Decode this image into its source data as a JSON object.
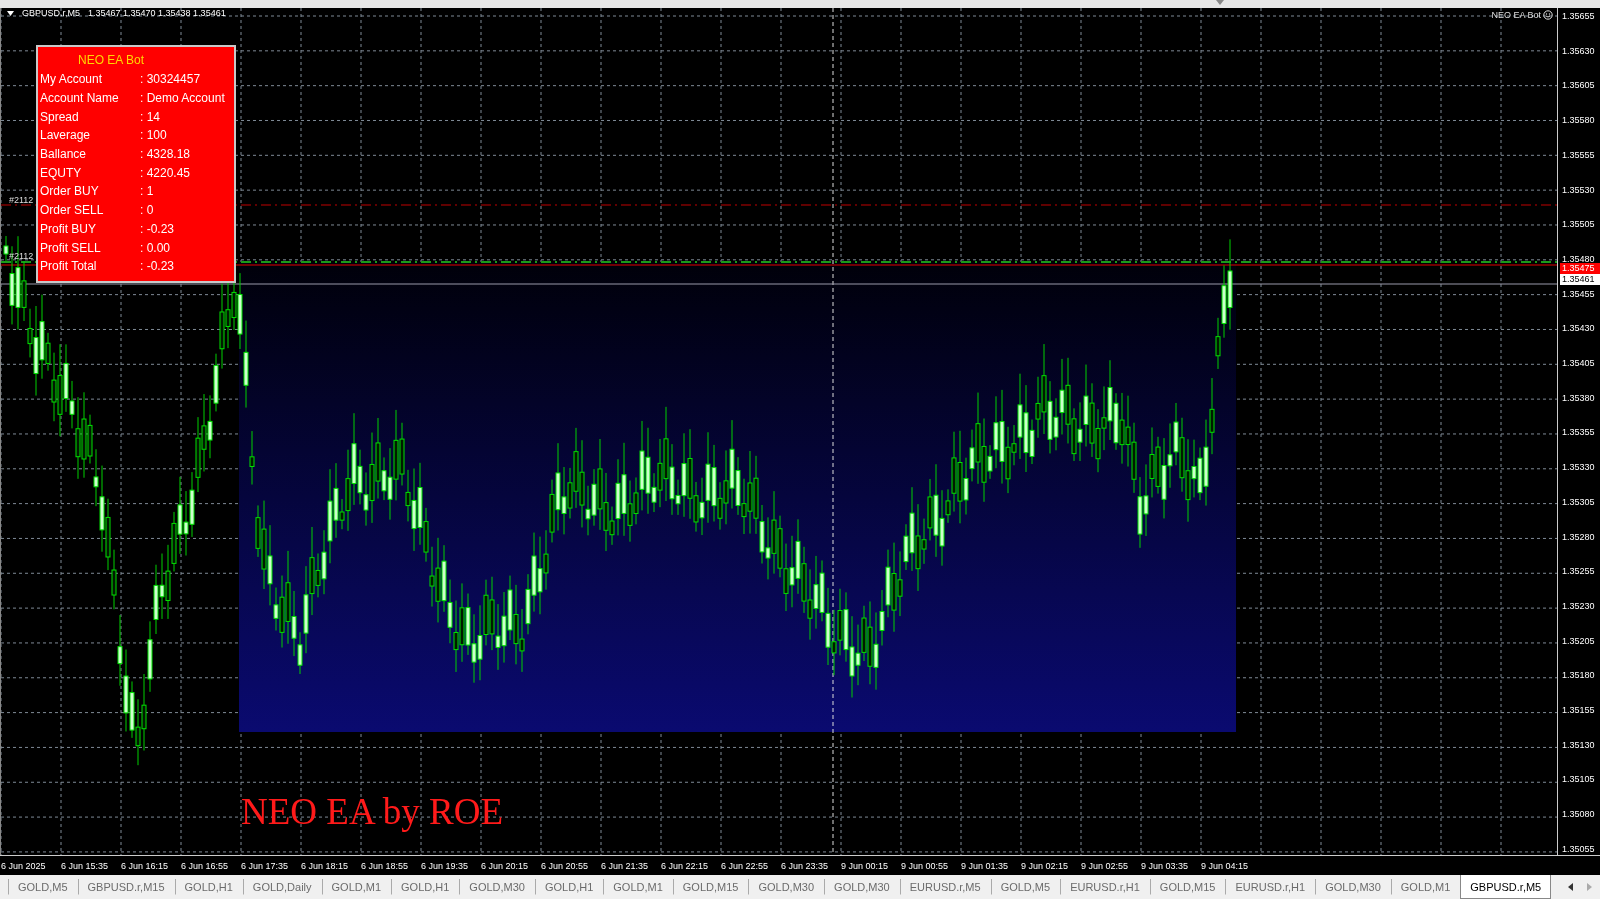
{
  "chart_header": {
    "symbol": "GBPUSD.r,M5",
    "quotes": "1.35467 1.35470 1.35438 1.35461"
  },
  "expert_label": {
    "name": "NEO EA Bot"
  },
  "info_panel": {
    "title": "NEO EA Bot",
    "rows": [
      {
        "label": "My Account",
        "value": ": 30324457"
      },
      {
        "label": "Account Name",
        "value": ": Demo Account"
      },
      {
        "label": "Spread",
        "value": ": 14"
      },
      {
        "label": "Laverage",
        "value": ": 100"
      },
      {
        "label": "Ballance",
        "value": ": 4328.18"
      },
      {
        "label": "EQUTY",
        "value": ": 4220.45"
      },
      {
        "label": "Order BUY",
        "value": ": 1"
      },
      {
        "label": "Order SELL",
        "value": ": 0"
      },
      {
        "label": "Profit BUY",
        "value": ": -0.23"
      },
      {
        "label": "Profit SELL",
        "value": ": 0.00"
      },
      {
        "label": "Profit Total",
        "value": ": -0.23"
      }
    ]
  },
  "order_labels": [
    "#2112",
    "#2112"
  ],
  "chart_caption": "NEO EA by ROE",
  "price_axis": [
    "1.35655",
    "1.35630",
    "1.35605",
    "1.35580",
    "1.35555",
    "1.35530",
    "1.35505",
    "1.35480",
    "1.35455",
    "1.35430",
    "1.35405",
    "1.35380",
    "1.35355",
    "1.35330",
    "1.35305",
    "1.35280",
    "1.35255",
    "1.35230",
    "1.35205",
    "1.35180",
    "1.35155",
    "1.35130",
    "1.35105",
    "1.35080",
    "1.35055"
  ],
  "price_tags": [
    {
      "text": "1.35475",
      "kind": "line"
    },
    {
      "text": "1.35461",
      "kind": "bid"
    }
  ],
  "time_axis": [
    "6 Jun 2025",
    "6 Jun 15:35",
    "6 Jun 16:15",
    "6 Jun 16:55",
    "6 Jun 17:35",
    "6 Jun 18:15",
    "6 Jun 18:55",
    "6 Jun 19:35",
    "6 Jun 20:15",
    "6 Jun 20:55",
    "6 Jun 21:35",
    "6 Jun 22:15",
    "6 Jun 22:55",
    "6 Jun 23:35",
    "9 Jun 00:15",
    "9 Jun 00:55",
    "9 Jun 01:35",
    "9 Jun 02:15",
    "9 Jun 02:55",
    "9 Jun 03:35",
    "9 Jun 04:15"
  ],
  "tabs": [
    {
      "label": "GOLD,M5",
      "selected": false
    },
    {
      "label": "GBPUSD.r,M15",
      "selected": false
    },
    {
      "label": "GOLD,H1",
      "selected": false
    },
    {
      "label": "GOLD,Daily",
      "selected": false
    },
    {
      "label": "GOLD,M1",
      "selected": false
    },
    {
      "label": "GOLD,H1",
      "selected": false
    },
    {
      "label": "GOLD,M30",
      "selected": false
    },
    {
      "label": "GOLD,H1",
      "selected": false
    },
    {
      "label": "GOLD,M1",
      "selected": false
    },
    {
      "label": "GOLD,M15",
      "selected": false
    },
    {
      "label": "GOLD,M30",
      "selected": false
    },
    {
      "label": "GOLD,M30",
      "selected": false
    },
    {
      "label": "EURUSD.r,M5",
      "selected": false
    },
    {
      "label": "GOLD,M5",
      "selected": false
    },
    {
      "label": "EURUSD.r,H1",
      "selected": false
    },
    {
      "label": "GOLD,M15",
      "selected": false
    },
    {
      "label": "EURUSD.r,H1",
      "selected": false
    },
    {
      "label": "GOLD,M30",
      "selected": false
    },
    {
      "label": "GOLD,M1",
      "selected": false
    },
    {
      "label": "GBPUSD.r,M5",
      "selected": true
    }
  ]
}
